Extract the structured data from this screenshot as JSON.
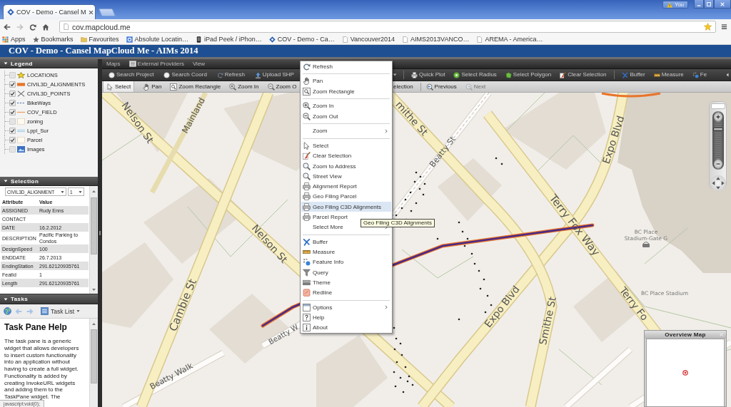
{
  "browser": {
    "tabs": [
      {
        "title": "COV - Demo - Cansel M",
        "selected": true
      }
    ],
    "profile": "You",
    "url": "cov.mapcloud.me",
    "bookmarks": [
      {
        "label": "Apps"
      },
      {
        "label": "Bookmarks"
      },
      {
        "label": "Favourites"
      },
      {
        "label": "Absolute Locatin…"
      },
      {
        "label": "iPad Peek / iPhon…"
      },
      {
        "label": "COV - Demo - Ca…"
      },
      {
        "label": "Vancouver2014"
      },
      {
        "label": "AIMS2013VANCO…"
      },
      {
        "label": "AREMA - America…"
      }
    ]
  },
  "app": {
    "title": "COV - Demo - Cansel MapCloud Me - AIMs 2014"
  },
  "legend": {
    "title": "Legend",
    "layers": [
      {
        "name": "LOCATIONS",
        "checked": false
      },
      {
        "name": "CIVIL3D_ALIGNMENTS",
        "checked": true
      },
      {
        "name": "CIVIL3D_POINTS",
        "checked": true
      },
      {
        "name": "BikeWays",
        "checked": true
      },
      {
        "name": "COV_FIELD",
        "checked": true
      },
      {
        "name": "zoning",
        "checked": false
      },
      {
        "name": "Lppl_Sur",
        "checked": true
      },
      {
        "name": "Parcel",
        "checked": true
      },
      {
        "name": "Images",
        "checked": false
      }
    ]
  },
  "selection": {
    "title": "Selection",
    "layer": "CIVIL3D_ALIGNMENT",
    "feature": "1",
    "columns": [
      "Attribute",
      "Value"
    ],
    "rows": [
      {
        "attribute": "ASSIGNED",
        "value": "Rudy Enns"
      },
      {
        "attribute": "CONTACT"
      },
      {
        "attribute": "DATE",
        "value": "16.2.2012"
      },
      {
        "attribute": "DESCRIPTION",
        "value": "Pacific Parking to Condos"
      },
      {
        "attribute": "DesignSpeed",
        "value": "100"
      },
      {
        "attribute": "ENDDATE",
        "value": "26.7.2013"
      },
      {
        "attribute": "EndingStation",
        "value": "291.62120935761"
      },
      {
        "attribute": "FeatId",
        "value": "1"
      },
      {
        "attribute": "Length",
        "value": "291.62120935761"
      }
    ]
  },
  "tasks": {
    "title": "Tasks",
    "menu": "Task List",
    "heading": "Task Pane Help",
    "text": "The task pane is a generic widget that allows developers to insert custom functionality into an application without having to create a full widget. Functionality is added by creating InvokeURL widgets and adding them to the TaskPane widget. The"
  },
  "map": {
    "menu": [
      {
        "label": "Maps"
      },
      {
        "label": "External Providers"
      },
      {
        "label": "View"
      }
    ],
    "toolbar_1": {
      "groups": [
        {
          "items": [
            {
              "label": "Search Project"
            },
            {
              "label": "Search Coord"
            },
            {
              "label": "Refresh"
            },
            {
              "label": "Upload SHP"
            }
          ]
        },
        {
          "items": [
            {
              "label": "Quick Plot"
            },
            {
              "label": "Select Radius"
            },
            {
              "label": "Select Polygon"
            },
            {
              "label": "Clear Selection"
            }
          ]
        },
        {
          "items": [
            {
              "label": "Buffer"
            },
            {
              "label": "Measure"
            },
            {
              "label": "Fe"
            }
          ]
        }
      ]
    },
    "toolbar_2": {
      "groups": [
        {
          "items": [
            {
              "label": "Select",
              "selected": true,
              "disabled": false
            },
            {
              "label": "Pan",
              "selected": false,
              "disabled": false
            },
            {
              "label": "Zoom Rectangle",
              "selected": false,
              "disabled": false
            },
            {
              "label": "Zoom In",
              "selected": false,
              "disabled": false
            },
            {
              "label": "Zoom O",
              "selected": false,
              "disabled": false
            }
          ]
        },
        {
          "items": [
            {
              "label": "election",
              "selected": false,
              "disabled": false
            }
          ]
        },
        {
          "items": [
            {
              "label": "Previous",
              "selected": false,
              "disabled": false
            },
            {
              "label": "Next",
              "selected": false,
              "disabled": true
            }
          ]
        }
      ]
    },
    "street_labels": [
      "Nelson St",
      "Mainland",
      "mithe St",
      "Beatty St",
      "Expo Blvd",
      "Terry Fox Way",
      "Nelson St",
      "Expo Blvd",
      "Smithe St",
      "Terry Fo",
      "Cambie St",
      "Beatty W",
      "Beatty Walk"
    ],
    "place_labels": [
      {
        "lines": [
          "BC Place",
          "Stadium-Gate G"
        ]
      },
      {
        "lines": [
          "BC Place Stadium"
        ]
      }
    ],
    "zoom_slider": {
      "level": 0.85
    },
    "overview": {
      "title": "Overview Map"
    }
  },
  "context_menu": {
    "groups": [
      {
        "items": [
          {
            "label": "Refresh",
            "submenu": false,
            "selected": false
          }
        ]
      },
      {
        "items": [
          {
            "label": "Pan",
            "submenu": false,
            "selected": false
          },
          {
            "label": "Zoom Rectangle",
            "submenu": false,
            "selected": false
          }
        ]
      },
      {
        "items": [
          {
            "label": "Zoom In",
            "submenu": false,
            "selected": false
          },
          {
            "label": "Zoom Out",
            "submenu": false,
            "selected": false
          }
        ]
      },
      {
        "items": [
          {
            "label": "Zoom",
            "submenu": true,
            "selected": false
          }
        ]
      },
      {
        "items": [
          {
            "label": "Select",
            "submenu": false,
            "selected": false
          },
          {
            "label": "Clear Selection",
            "submenu": false,
            "selected": false
          },
          {
            "label": "Zoom to Address",
            "submenu": false,
            "selected": false
          },
          {
            "label": "Street View",
            "submenu": false,
            "selected": false
          },
          {
            "label": "Alignment Report",
            "submenu": false,
            "selected": false
          },
          {
            "label": "Geo Filing Parcel",
            "submenu": false,
            "selected": false
          },
          {
            "label": "Geo Filing C3D Alignments",
            "submenu": false,
            "selected": true
          },
          {
            "label": "Parcel Report",
            "submenu": false,
            "selected": false
          },
          {
            "label": "Select More",
            "submenu": true,
            "selected": false
          }
        ]
      },
      {
        "items": [
          {
            "label": "Buffer",
            "submenu": false,
            "selected": false
          },
          {
            "label": "Measure",
            "submenu": false,
            "selected": false
          },
          {
            "label": "Feature Info",
            "submenu": false,
            "selected": false
          },
          {
            "label": "Query",
            "submenu": false,
            "selected": false
          },
          {
            "label": "Theme",
            "submenu": false,
            "selected": false
          },
          {
            "label": "Redline",
            "submenu": false,
            "selected": false
          }
        ]
      },
      {
        "items": [
          {
            "label": "Options",
            "submenu": true,
            "selected": false
          },
          {
            "label": "Help",
            "submenu": false,
            "selected": false
          },
          {
            "label": "About",
            "submenu": false,
            "selected": false
          }
        ]
      }
    ]
  },
  "tooltip": "Geo Filing C3D Alignments",
  "status_bar": "javascript:void(0);"
}
